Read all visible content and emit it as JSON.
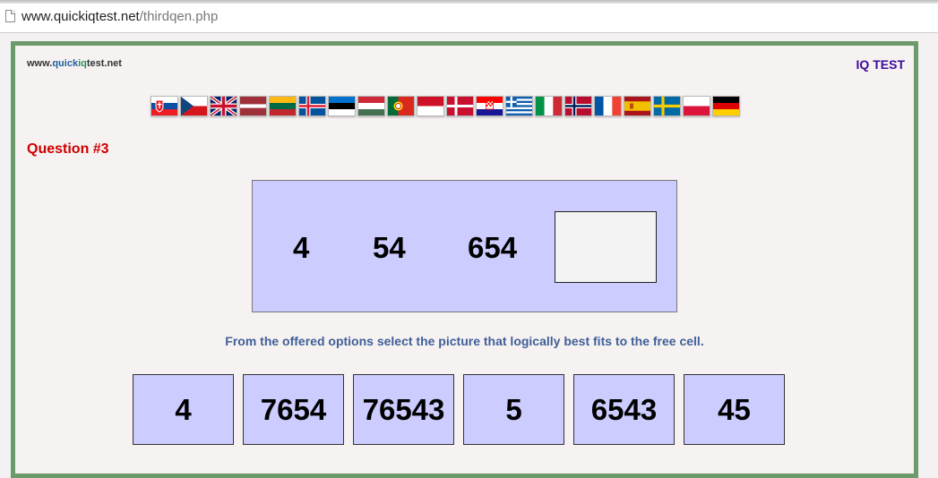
{
  "browser": {
    "url_host": "www.quickiqtest.net",
    "url_path": "/thirdqen.php"
  },
  "header": {
    "site_prefix": "www.",
    "site_quick": "quick",
    "site_iq": "iq",
    "site_suffix": "test.net",
    "iq_test_label": "IQ TEST"
  },
  "flags": [
    {
      "name": "slovakia-flag-icon"
    },
    {
      "name": "czech-flag-icon"
    },
    {
      "name": "uk-flag-icon"
    },
    {
      "name": "latvia-flag-icon"
    },
    {
      "name": "lithuania-flag-icon"
    },
    {
      "name": "iceland-flag-icon"
    },
    {
      "name": "estonia-flag-icon"
    },
    {
      "name": "hungary-flag-icon"
    },
    {
      "name": "portugal-flag-icon"
    },
    {
      "name": "indonesia-flag-icon"
    },
    {
      "name": "denmark-flag-icon"
    },
    {
      "name": "croatia-flag-icon"
    },
    {
      "name": "greece-flag-icon"
    },
    {
      "name": "italy-flag-icon"
    },
    {
      "name": "norway-flag-icon"
    },
    {
      "name": "france-flag-icon"
    },
    {
      "name": "spain-flag-icon"
    },
    {
      "name": "sweden-flag-icon"
    },
    {
      "name": "poland-flag-icon"
    },
    {
      "name": "germany-flag-icon"
    }
  ],
  "question": {
    "title": "Question #3",
    "sequence": [
      "4",
      "54",
      "654"
    ],
    "instruction": "From the offered options select the picture that logically best fits to the free cell."
  },
  "options": [
    "4",
    "7654",
    "76543",
    "5",
    "6543",
    "45"
  ],
  "colors": {
    "frame_border": "#6b9a6b",
    "tile_bg": "#ccccff",
    "question_red": "#cc0000",
    "instruction_blue": "#3f5f97"
  }
}
